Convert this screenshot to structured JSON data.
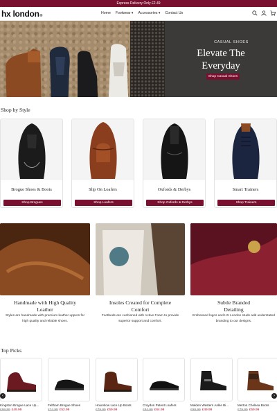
{
  "announcement": "Express Delivery Only £2.49",
  "brand": {
    "logo_text": "hx london",
    "logo_mark": "®"
  },
  "nav": [
    {
      "label": "Home"
    },
    {
      "label": "Footwear ▾"
    },
    {
      "label": "Accessories ▾"
    },
    {
      "label": "Contact Us"
    }
  ],
  "header_icons": [
    "search-icon",
    "user-icon",
    "cart-icon"
  ],
  "hero": {
    "subtitle": "CASUAL SHOES",
    "title_line1": "Elevate The",
    "title_line2": "Everyday",
    "button": "Shop Casual Shoes"
  },
  "shop_by_style": {
    "title": "Shop by Style",
    "cards": [
      {
        "label": "Brogue Shoes & Boots",
        "button": "Shop Brogues"
      },
      {
        "label": "Slip On Loafers",
        "button": "Shop Loafers"
      },
      {
        "label": "Oxfords & Derbys",
        "button": "Shop Oxfords & Derbys"
      },
      {
        "label": "Smart Trainers",
        "button": "Shop Trainers"
      }
    ]
  },
  "features": [
    {
      "title_line1": "Handmade with High Quality",
      "title_line2": "Leather",
      "text_line1": "Styles are handmade with premium leather uppers for",
      "text_line2": "high quality and reliable shoes."
    },
    {
      "title_line1": "Insoles Created for Complete",
      "title_line2": "Comfort",
      "text_line1": "Footbeds are cushioned with Active Foam to provide",
      "text_line2": "superior support and comfort."
    },
    {
      "title_line1": "Subtle Branded",
      "title_line2": "Detailing",
      "text_line1": "Embossed logos and HX London studs add understated",
      "text_line2": "branding to our designs."
    }
  ],
  "top_picks": {
    "title": "Top Picks",
    "products": [
      {
        "name": "Kingston Brogue Lace Up...",
        "was": "£99.99",
        "now": "£49.99"
      },
      {
        "name": "Feltham Brogue Shoes",
        "was": "£74.99",
        "now": "£52.99"
      },
      {
        "name": "Hounslow Lace Up Boots",
        "was": "£79.99",
        "now": "£59.99"
      },
      {
        "name": "Croydon Patent Loafers",
        "was": "£84.99",
        "now": "£64.99"
      },
      {
        "name": "Malden Western Ankle Bi...",
        "was": "£99.99",
        "now": "£49.99"
      },
      {
        "name": "Merton Chelsea Boots",
        "was": "£79.99",
        "now": "£59.99"
      }
    ]
  },
  "colors": {
    "accent": "#7a1030",
    "sale": "#b0102c"
  }
}
